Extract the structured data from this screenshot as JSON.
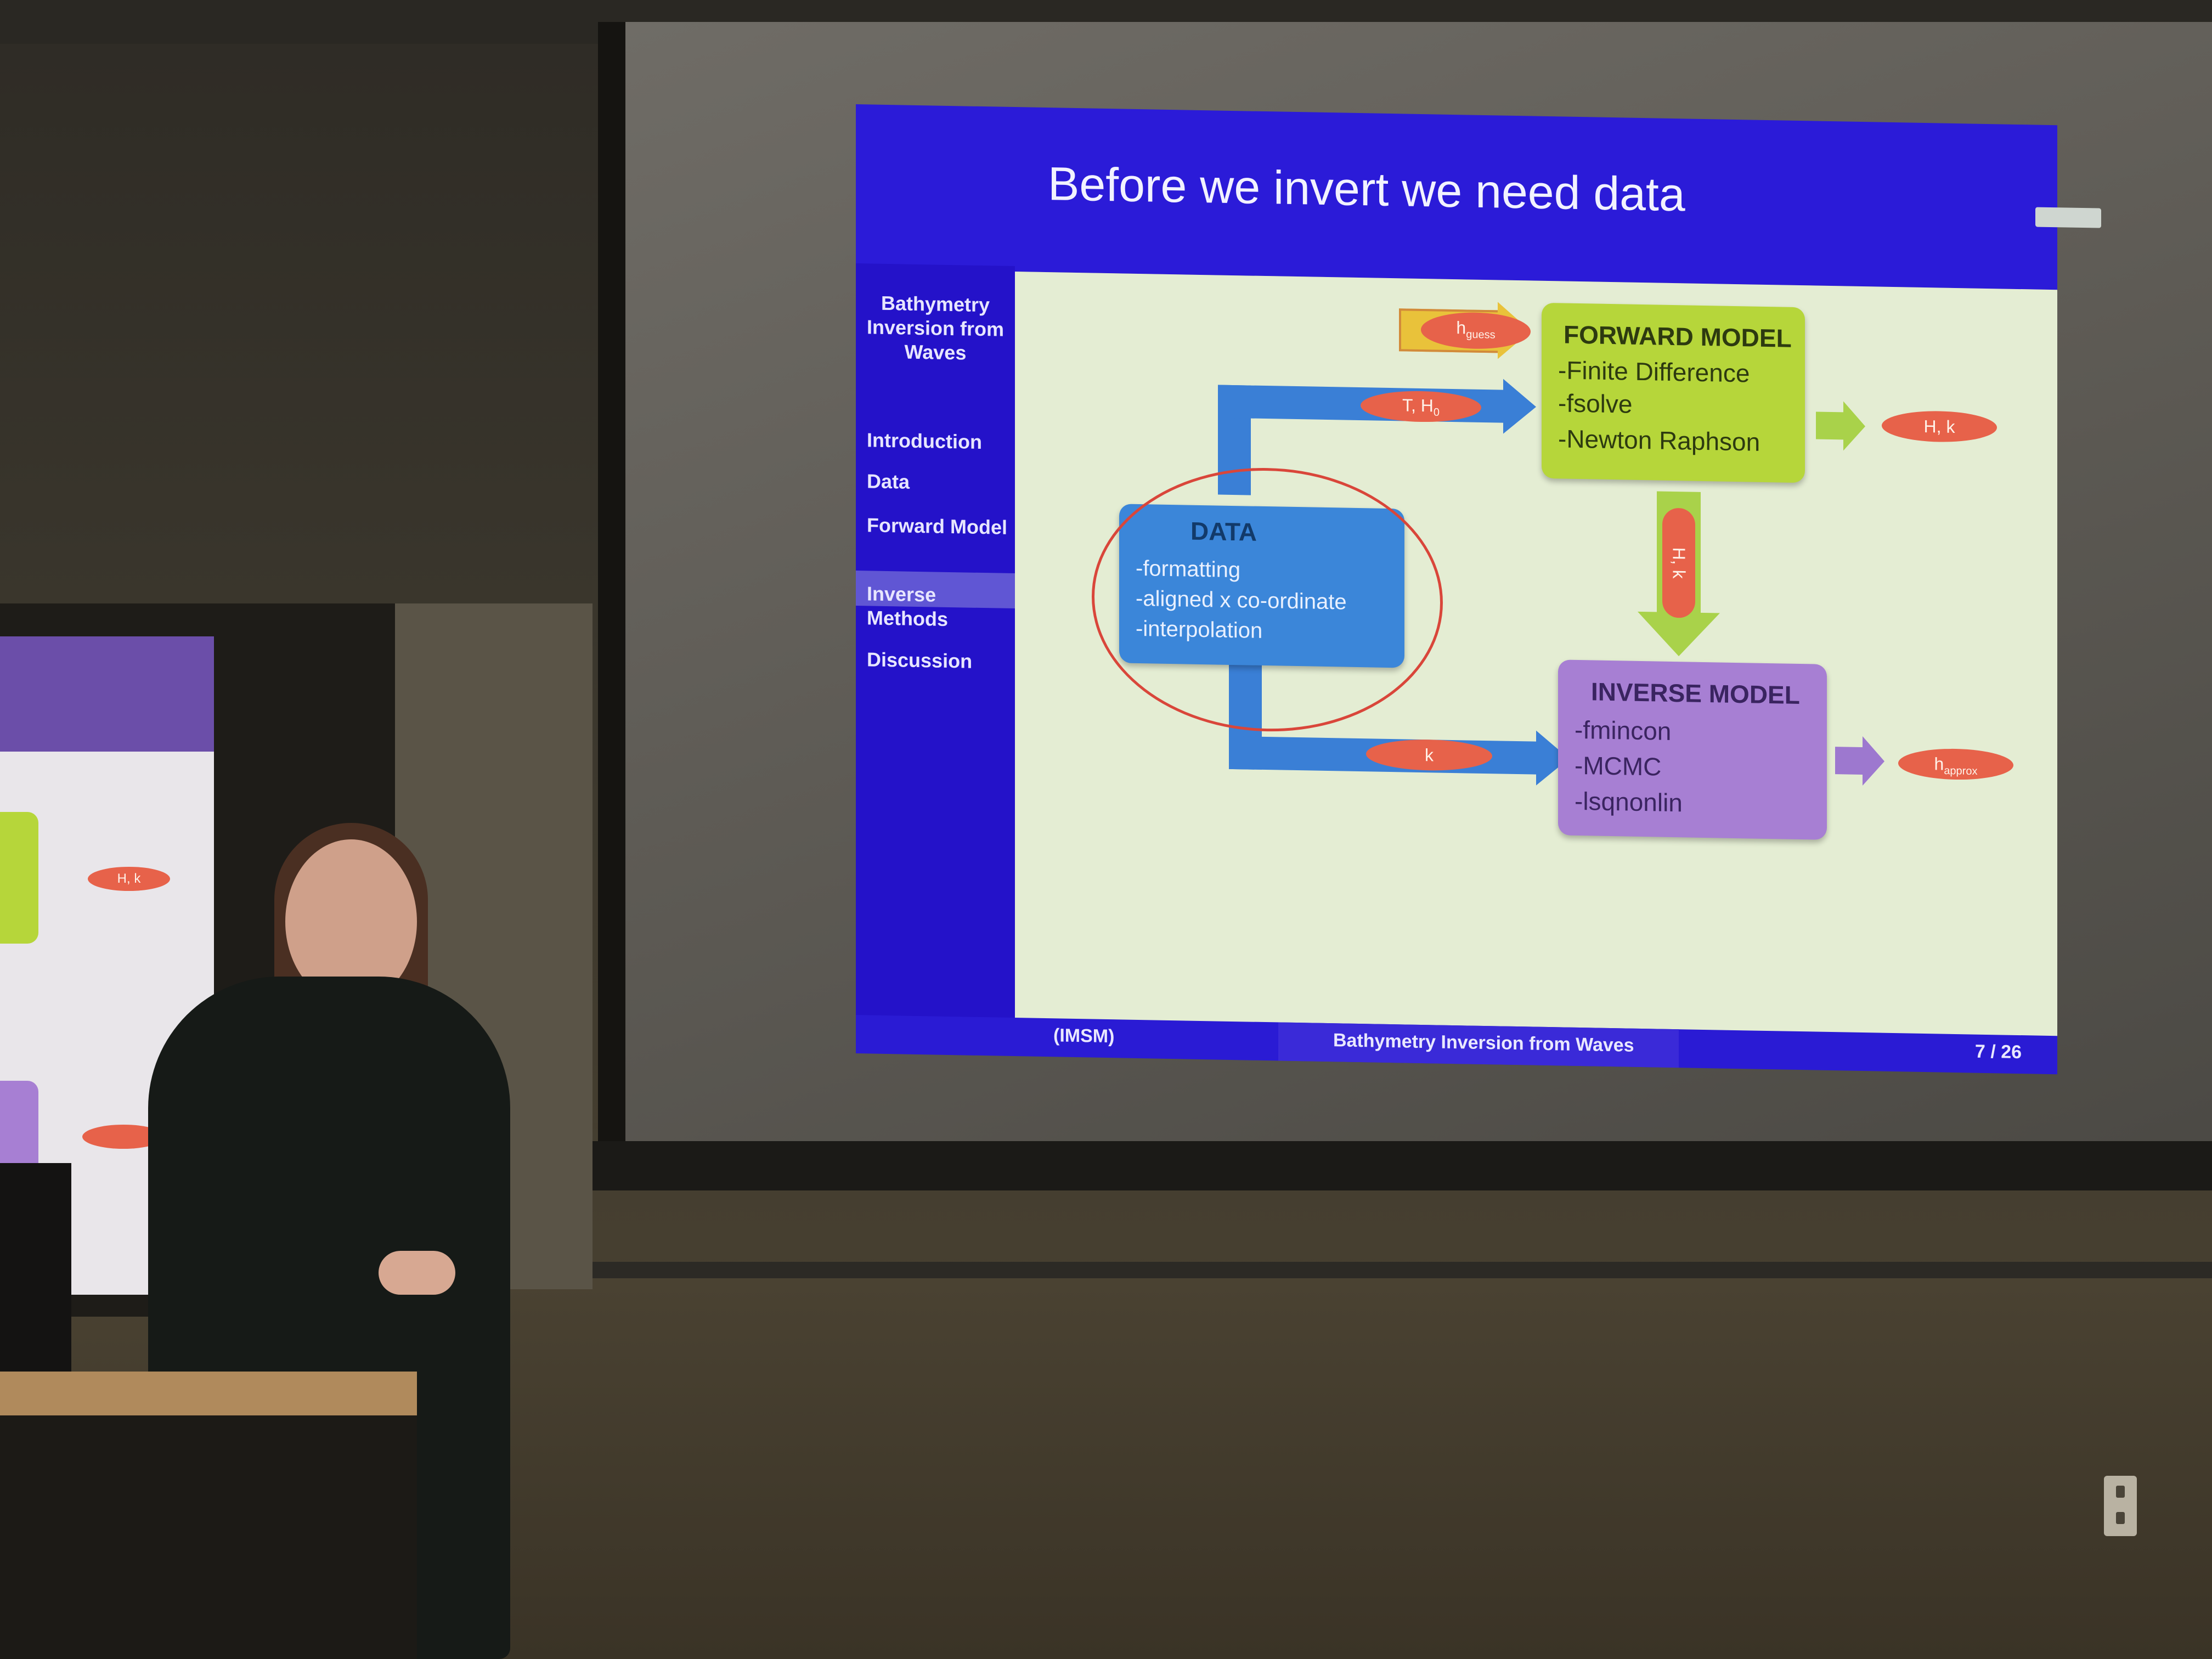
{
  "slide": {
    "title": "Before we invert we need data",
    "sidebar_title": "Bathymetry Inversion from Waves",
    "nav": [
      "Introduction",
      "Data",
      "Forward Model",
      "Inverse Methods",
      "Discussion"
    ],
    "active_nav": "Data",
    "footer_left": "(IMSM)",
    "footer_center": "Bathymetry Inversion from Waves",
    "footer_right": "7 / 26"
  },
  "diagram": {
    "data_box": {
      "title": "DATA",
      "lines": [
        "-formatting",
        "-aligned x co-ordinate",
        "-interpolation"
      ]
    },
    "forward_box": {
      "title": "FORWARD MODEL",
      "lines": [
        "-Finite Difference",
        "-fsolve",
        "-Newton Raphson"
      ]
    },
    "inverse_box": {
      "title": "INVERSE MODEL",
      "lines": [
        "-fmincon",
        "-MCMC",
        "-lsqnonlin"
      ]
    },
    "labels": {
      "h_guess": "h",
      "h_guess_sub": "guess",
      "t_h0": "T, H",
      "t_h0_sub": "0",
      "hk_out": "H, k",
      "hk_down": "H, k",
      "k": "k",
      "h_approx": "h",
      "h_approx_sub": "approx"
    },
    "colors": {
      "data": "#3b86d9",
      "forward": "#b6d63a",
      "inverse": "#a77fd3",
      "pill": "#e7624a",
      "arrow": "#3a7fd6",
      "highlight": "#d9463a"
    }
  },
  "left_display": {
    "pill_top": "H, k"
  }
}
